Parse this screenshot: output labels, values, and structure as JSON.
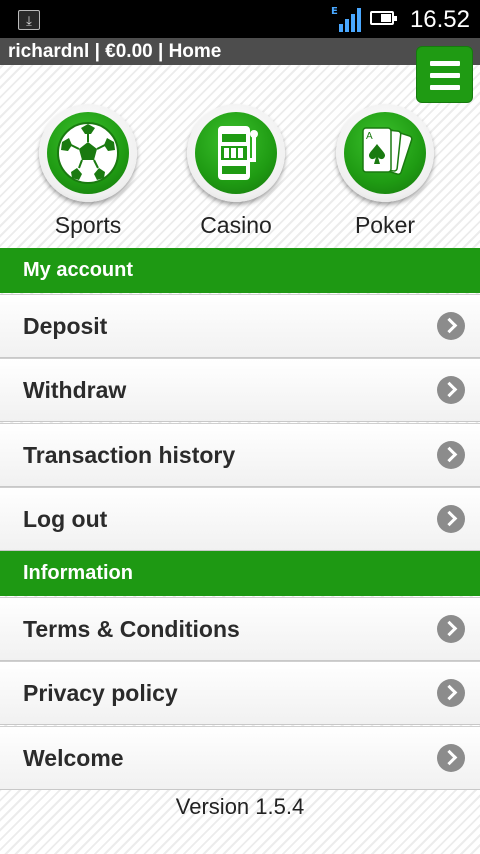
{
  "status_bar": {
    "time": "16.52",
    "network_type": "E",
    "download_icon": "download-icon"
  },
  "account_bar": {
    "text": "richardnl | €0.00 | Home"
  },
  "menu": {
    "icon": "hamburger-menu-icon"
  },
  "categories": [
    {
      "label": "Sports",
      "icon": "soccer-ball-icon"
    },
    {
      "label": "Casino",
      "icon": "slot-machine-icon"
    },
    {
      "label": "Poker",
      "icon": "playing-cards-icon"
    }
  ],
  "sections": [
    {
      "title": "My account",
      "items": [
        "Deposit",
        "Withdraw",
        "Transaction history",
        "Log out"
      ]
    },
    {
      "title": "Information",
      "items": [
        "Terms & Conditions",
        "Privacy policy",
        "Welcome"
      ]
    }
  ],
  "version": "Version 1.5.4",
  "colors": {
    "brand_green": "#1e9913",
    "header_gray": "#4d4d4d"
  }
}
